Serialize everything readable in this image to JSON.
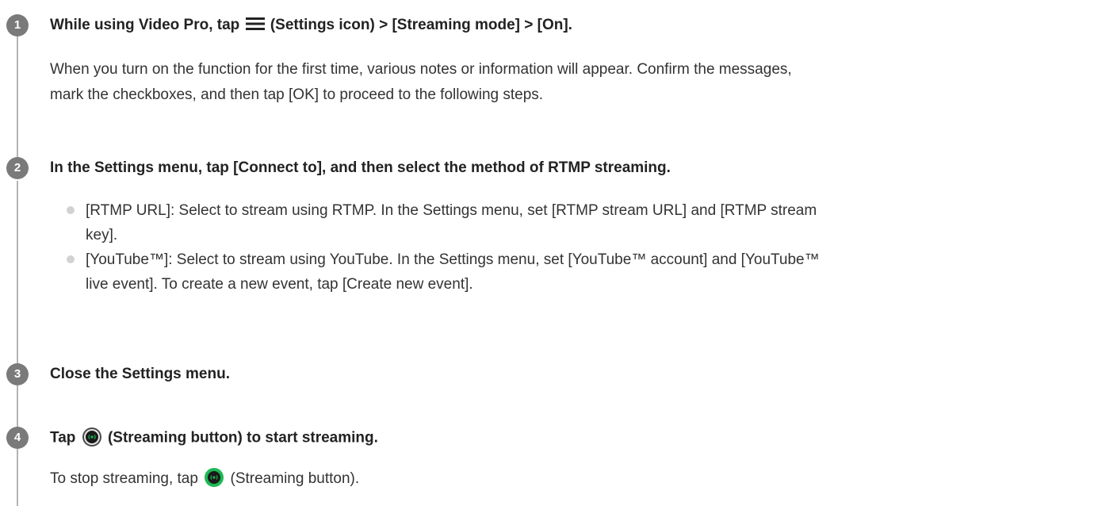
{
  "steps": [
    {
      "number": "1",
      "title_pre": "While using Video Pro, tap",
      "title_icon": "menu-icon",
      "title_post": "(Settings icon) > [Streaming mode] > [On].",
      "body_line1": "When you turn on the function for the first time, various notes or information will appear. Confirm the messages,",
      "body_line2": "mark the checkboxes, and then tap [OK] to proceed to the following steps."
    },
    {
      "number": "2",
      "title": "In the Settings menu, tap [Connect to], and then select the method of RTMP streaming.",
      "bullets": [
        {
          "line1": "[RTMP URL]: Select to stream using RTMP. In the Settings menu, set [RTMP stream URL] and [RTMP stream",
          "line2": "key]."
        },
        {
          "line1": "[YouTube™]: Select to stream using YouTube. In the Settings menu, set [YouTube™ account] and [YouTube™",
          "line2": "live event]. To create a new event, tap [Create new event]."
        }
      ]
    },
    {
      "number": "3",
      "title": "Close the Settings menu."
    },
    {
      "number": "4",
      "title_pre": "Tap",
      "title_icon": "streaming-button-icon",
      "title_post": "(Streaming button) to start streaming.",
      "body_pre": "To stop streaming, tap",
      "body_icon": "streaming-button-active-icon",
      "body_post": "(Streaming button)."
    }
  ],
  "colors": {
    "step_circle": "#7a7a7a",
    "step_line": "#b3b3b3",
    "bullet": "#d2d2d2",
    "stream_button_ring": "#4a4a4a",
    "stream_button_active": "#1db954"
  }
}
